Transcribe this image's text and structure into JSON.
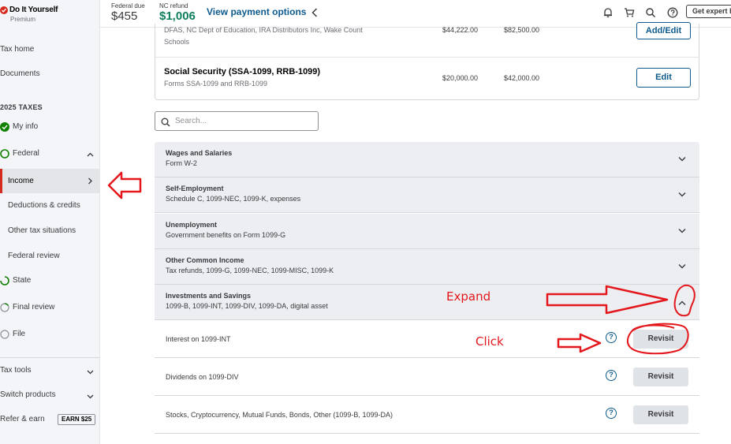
{
  "brand": {
    "name": "Do It Yourself",
    "tier": "Premium"
  },
  "sidebar": {
    "links": [
      "Tax home",
      "Documents"
    ],
    "section_title": "2025 TAXES",
    "steps": {
      "my_info": "My info",
      "federal": "Federal",
      "federal_sub": [
        "Income",
        "Deductions & credits",
        "Other tax situations",
        "Federal review"
      ],
      "state": "State",
      "final_review": "Final review",
      "file": "File"
    },
    "bottom": {
      "tax_tools": "Tax tools",
      "switch_products": "Switch products",
      "refer": "Refer & earn",
      "earn_badge": "EARN $25"
    }
  },
  "topbar": {
    "federal_label": "Federal due",
    "federal_amount": "$455",
    "nc_label": "NC refund",
    "nc_amount": "$1,006",
    "payment_link": "View payment options",
    "expert_button": "Get expert help"
  },
  "summary_rows": [
    {
      "subtitle_line1": "DFAS, NC Dept of Education, IRA Distributors Inc, Wake Count",
      "subtitle_line2": "Schools",
      "amount1": "$44,222.00",
      "amount2": "$82,500.00",
      "button": "Add/Edit"
    },
    {
      "title": "Social Security (SSA-1099, RRB-1099)",
      "subtitle": "Forms SSA-1099 and RRB-1099",
      "amount1": "$20,000.00",
      "amount2": "$42,000.00",
      "button": "Edit"
    }
  ],
  "search": {
    "placeholder": "Search..."
  },
  "accordion": [
    {
      "title": "Wages and Salaries",
      "subtitle": "Form W-2",
      "expanded": false
    },
    {
      "title": "Self-Employment",
      "subtitle": "Schedule C, 1099-NEC, 1099-K, expenses",
      "expanded": false
    },
    {
      "title": "Unemployment",
      "subtitle": "Government benefits on Form 1099-G",
      "expanded": false
    },
    {
      "title": "Other Common Income",
      "subtitle": "Tax refunds, 1099-G, 1099-NEC, 1099-MISC, 1099-K",
      "expanded": false
    },
    {
      "title": "Investments and Savings",
      "subtitle": "1099-B, 1099-INT, 1099-DIV, 1099-DA, digital asset",
      "expanded": true
    }
  ],
  "investment_rows": [
    {
      "label": "Interest on 1099-INT",
      "button": "Revisit"
    },
    {
      "label": "Dividends on 1099-DIV",
      "button": "Revisit"
    },
    {
      "label": "Stocks, Cryptocurrency, Mutual Funds, Bonds, Other (1099-B, 1099-DA)",
      "button": "Revisit"
    }
  ],
  "annotations": {
    "expand": "Expand",
    "click": "Click"
  },
  "colors": {
    "accent": "#0d5a8c",
    "brand_red": "#d52b1e",
    "refund_green": "#0f7e5d",
    "annotation_red": "#e3171c",
    "accordion_bg": "#eceef1"
  }
}
